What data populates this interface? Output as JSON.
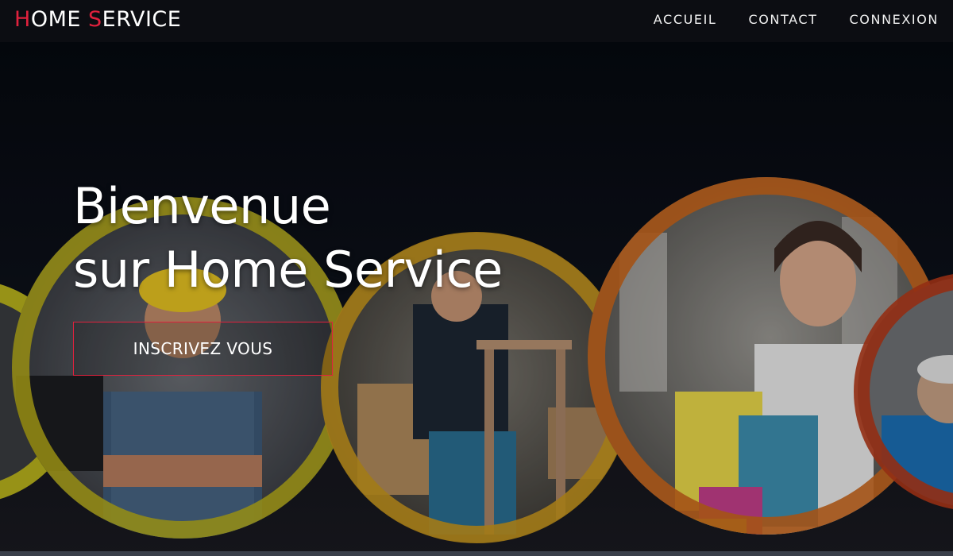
{
  "header": {
    "logo": {
      "first_initial": "H",
      "first_rest": "OME ",
      "second_initial": "S",
      "second_rest": "ERVICE"
    },
    "nav": {
      "home": "ACCUEIL",
      "contact": "CONTACT",
      "login": "CONNEXION"
    }
  },
  "hero": {
    "title_line1": "Bienvenue",
    "title_line2": "sur Home Service",
    "cta_label": "INSCRIVEZ VOUS"
  },
  "colors": {
    "accent": "#e0213d",
    "navbar_bg": "#0c0d12",
    "text": "#ffffff"
  }
}
